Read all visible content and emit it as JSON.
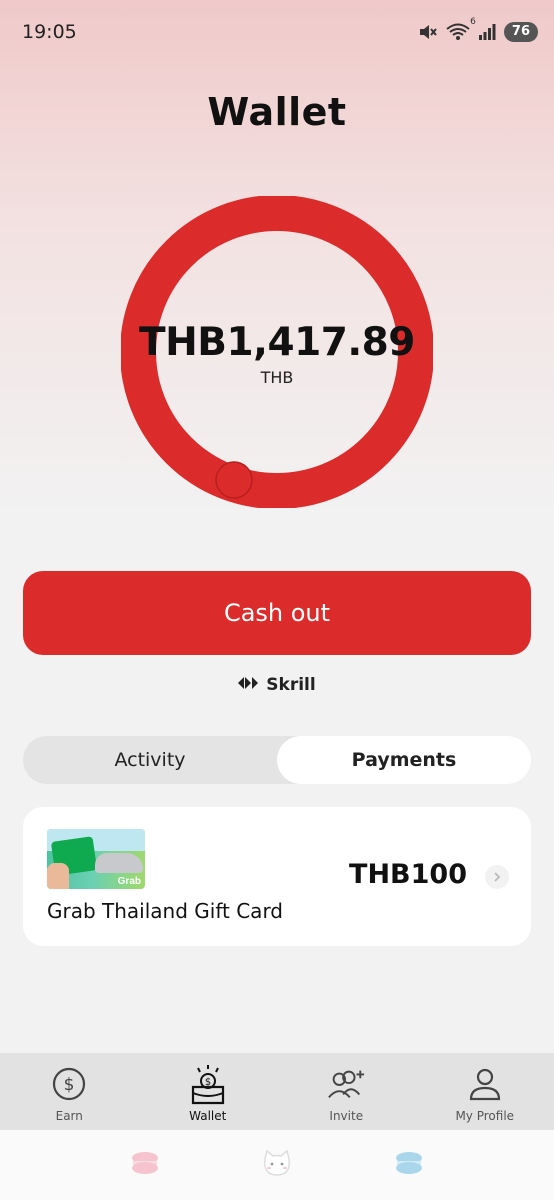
{
  "status_bar": {
    "time": "19:05",
    "wifi_badge": "6",
    "battery": "76",
    "icons": [
      "mute-icon",
      "wifi-icon",
      "signal-icon",
      "battery-icon"
    ]
  },
  "page": {
    "title": "Wallet"
  },
  "balance": {
    "amount": "THB1,417.89",
    "currency": "THB",
    "ring_color": "#dc2b2b"
  },
  "cashout": {
    "label": "Cash out",
    "color": "#dc2b2b"
  },
  "provider": {
    "name": "Skrill",
    "icon": "skrill-logo-icon"
  },
  "tabs": [
    {
      "label": "Activity",
      "active": false
    },
    {
      "label": "Payments",
      "active": true
    }
  ],
  "payments": [
    {
      "name": "Grab Thailand Gift Card",
      "amount": "THB100",
      "thumb_brand": "Grab"
    }
  ],
  "bottom_nav": [
    {
      "label": "Earn",
      "icon": "dollar-coin-icon",
      "active": false
    },
    {
      "label": "Wallet",
      "icon": "wallet-icon",
      "active": true
    },
    {
      "label": "Invite",
      "icon": "invite-users-icon",
      "active": false
    },
    {
      "label": "My Profile",
      "icon": "profile-icon",
      "active": false
    }
  ],
  "system_bar": {
    "icons": [
      "macaron-pink-icon",
      "cat-icon",
      "macaron-blue-icon"
    ]
  }
}
